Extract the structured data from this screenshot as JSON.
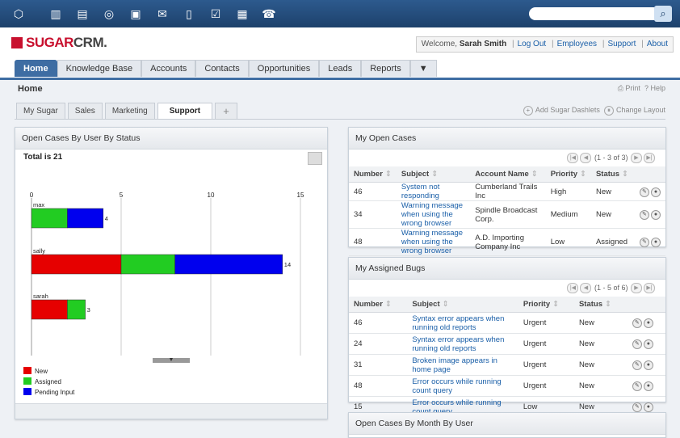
{
  "topbar": {
    "icons": [
      "cube-icon",
      "building-icon",
      "id-card-icon",
      "coins-icon",
      "briefcase-icon",
      "mail-icon",
      "document-icon",
      "clipboard-icon",
      "calendar-icon",
      "phone-icon"
    ],
    "search_placeholder": ""
  },
  "header": {
    "logo_red": "SUGAR",
    "logo_gray": "CRM.",
    "welcome": "Welcome,",
    "user": "Sarah Smith",
    "links": [
      "Log Out",
      "Employees",
      "Support",
      "About"
    ]
  },
  "nav": {
    "tabs": [
      "Home",
      "Knowledge Base",
      "Accounts",
      "Contacts",
      "Opportunities",
      "Leads",
      "Reports",
      "▼"
    ]
  },
  "breadcrumb": "Home",
  "page_actions": {
    "print": "Print",
    "help": "Help"
  },
  "subtabs": [
    "My Sugar",
    "Sales",
    "Marketing",
    "Support",
    "+"
  ],
  "dash_actions": {
    "add": "Add Sugar Dashlets",
    "layout": "Change Layout"
  },
  "chart_panel": {
    "title": "Open Cases By User By Status",
    "total": "Total is 21",
    "legend": [
      {
        "label": "New",
        "color": "#e60000"
      },
      {
        "label": "Assigned",
        "color": "#22cc22"
      },
      {
        "label": "Pending Input",
        "color": "#0000ee"
      }
    ]
  },
  "chart_data": {
    "type": "bar",
    "orientation": "horizontal",
    "stacked": true,
    "title": "Total is 21",
    "xlim": [
      0,
      15
    ],
    "xticks": [
      0,
      5,
      10,
      15
    ],
    "categories": [
      "max",
      "sally",
      "sarah"
    ],
    "series": [
      {
        "name": "New",
        "values": [
          0,
          5,
          2
        ],
        "color": "#e60000"
      },
      {
        "name": "Assigned",
        "values": [
          2,
          3,
          1
        ],
        "color": "#22cc22"
      },
      {
        "name": "Pending Input",
        "values": [
          2,
          6,
          0
        ],
        "color": "#0000ee"
      }
    ],
    "totals": [
      "4",
      "14",
      "3"
    ]
  },
  "open_cases": {
    "title": "My Open Cases",
    "pager": "(1 - 3 of 3)",
    "columns": [
      "Number",
      "Subject",
      "Account Name",
      "Priority",
      "Status"
    ],
    "rows": [
      {
        "number": "46",
        "subject": "System not responding",
        "account": "Cumberland Trails Inc",
        "priority": "High",
        "status": "New"
      },
      {
        "number": "34",
        "subject": "Warning message when using the wrong browser",
        "account": "Spindle Broadcast Corp.",
        "priority": "Medium",
        "status": "New"
      },
      {
        "number": "48",
        "subject": "Warning message when using the wrong browser",
        "account": "A.D. Importing Company Inc",
        "priority": "Low",
        "status": "Assigned"
      }
    ]
  },
  "bugs": {
    "title": "My Assigned Bugs",
    "pager": "(1 - 5 of 6)",
    "columns": [
      "Number",
      "Subject",
      "Priority",
      "Status"
    ],
    "rows": [
      {
        "number": "46",
        "subject": "Syntax error appears when running old reports",
        "priority": "Urgent",
        "status": "New"
      },
      {
        "number": "24",
        "subject": "Syntax error appears when running old reports",
        "priority": "Urgent",
        "status": "New"
      },
      {
        "number": "31",
        "subject": "Broken image appears in home page",
        "priority": "Urgent",
        "status": "New"
      },
      {
        "number": "48",
        "subject": "Error occurs while running count query",
        "priority": "Urgent",
        "status": "New"
      },
      {
        "number": "15",
        "subject": "Error occurs while running count query",
        "priority": "Low",
        "status": "New"
      }
    ]
  },
  "month_panel": {
    "title": "Open Cases By Month By User"
  }
}
